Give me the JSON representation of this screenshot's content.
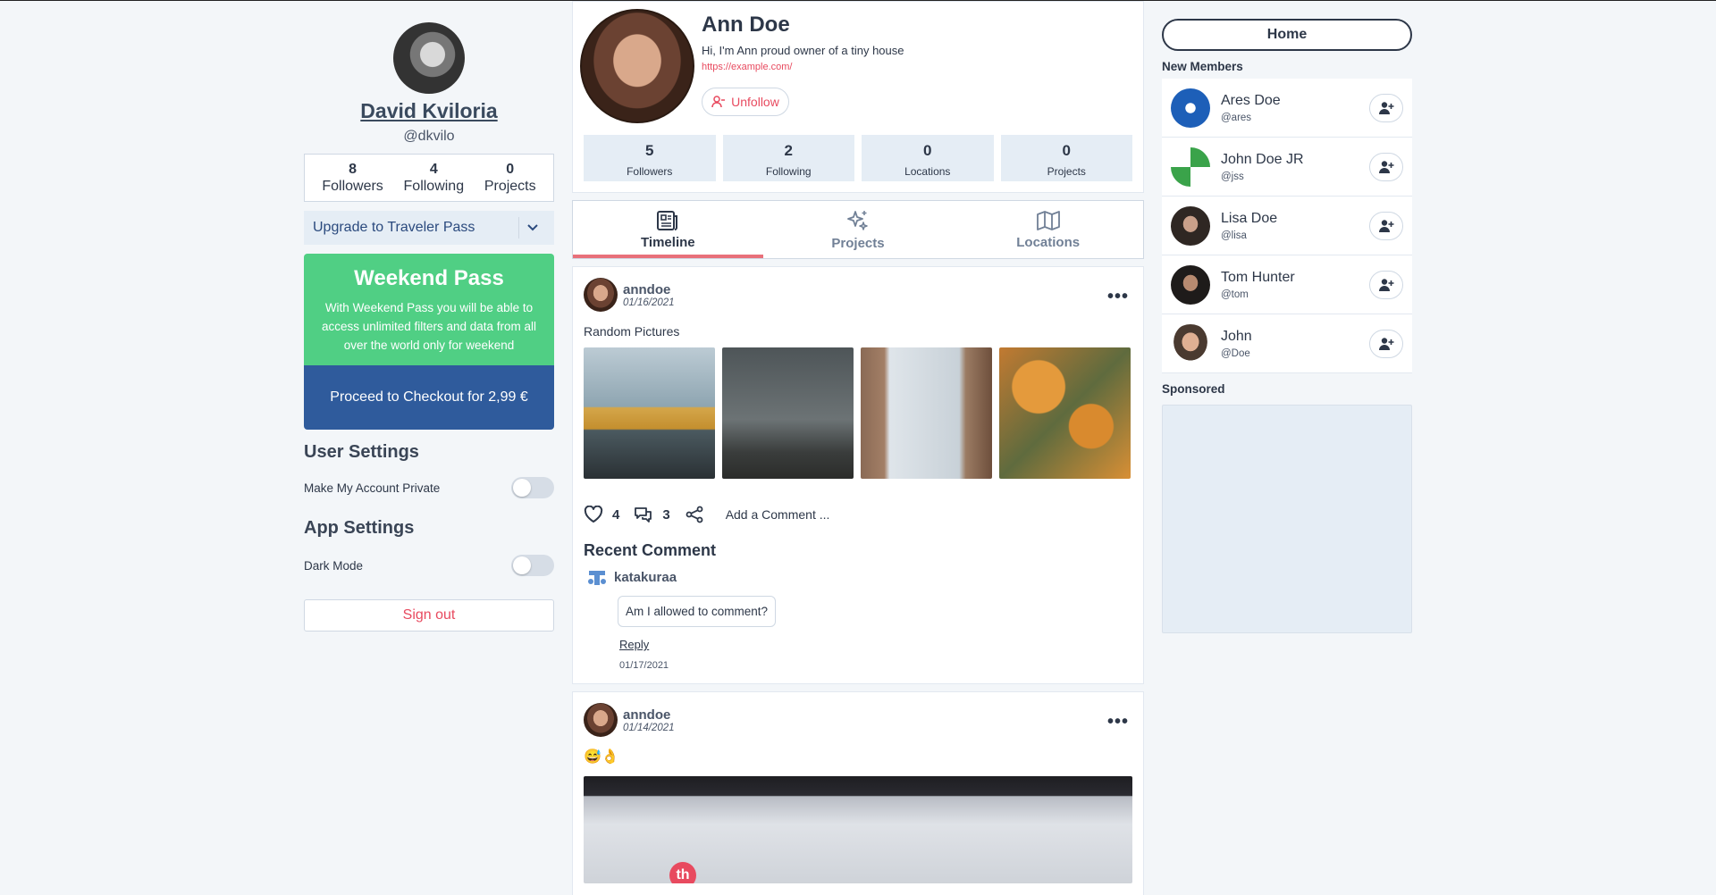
{
  "user": {
    "name": "David Kviloria",
    "handle": "@dkvilo",
    "stats": [
      {
        "value": "8",
        "label": "Followers"
      },
      {
        "value": "4",
        "label": "Following"
      },
      {
        "value": "0",
        "label": "Projects"
      }
    ],
    "upgrade_label": "Upgrade to Traveler Pass"
  },
  "pass": {
    "title": "Weekend Pass",
    "description": "With Weekend Pass you will be able to access unlimited filters and data from all over the world only for weekend",
    "checkout_label": "Proceed to Checkout for 2,99 €"
  },
  "settings": {
    "user_title": "User Settings",
    "private_label": "Make My Account Private",
    "private_on": false,
    "app_title": "App Settings",
    "dark_label": "Dark Mode",
    "dark_on": false,
    "signout_label": "Sign out"
  },
  "profile": {
    "name": "Ann Doe",
    "bio": "Hi, I'm Ann proud owner of a tiny house",
    "link": "https://example.com/",
    "unfollow_label": "Unfollow",
    "stats": [
      {
        "value": "5",
        "label": "Followers"
      },
      {
        "value": "2",
        "label": "Following"
      },
      {
        "value": "0",
        "label": "Locations"
      },
      {
        "value": "0",
        "label": "Projects"
      }
    ]
  },
  "tabs": [
    {
      "label": "Timeline",
      "icon": "newspaper-icon",
      "active": true
    },
    {
      "label": "Projects",
      "icon": "sparkles-icon",
      "active": false
    },
    {
      "label": "Locations",
      "icon": "map-icon",
      "active": false
    }
  ],
  "posts": [
    {
      "user": "anndoe",
      "date": "01/16/2021",
      "text": "Random Pictures",
      "likes": "4",
      "comments": "3",
      "add_comment": "Add a Comment ...",
      "recent_title": "Recent Comment",
      "recent_user": "katakuraa",
      "recent_text": "Am I allowed to comment?",
      "reply_label": "Reply",
      "recent_date": "01/17/2021"
    },
    {
      "user": "anndoe",
      "date": "01/14/2021",
      "text": "😅👌",
      "photo_logo": "th"
    }
  ],
  "sidebar": {
    "home_label": "Home",
    "new_members_title": "New Members",
    "members": [
      {
        "name": "Ares Doe",
        "handle": "@ares"
      },
      {
        "name": "John Doe JR",
        "handle": "@jss"
      },
      {
        "name": "Lisa Doe",
        "handle": "@lisa"
      },
      {
        "name": "Tom Hunter",
        "handle": "@tom"
      },
      {
        "name": "John",
        "handle": "@Doe"
      }
    ],
    "sponsored_title": "Sponsored"
  },
  "colors": {
    "accent_red": "#e84a5f",
    "pass_green": "#50cf84",
    "pass_blue": "#2f5b9c"
  }
}
